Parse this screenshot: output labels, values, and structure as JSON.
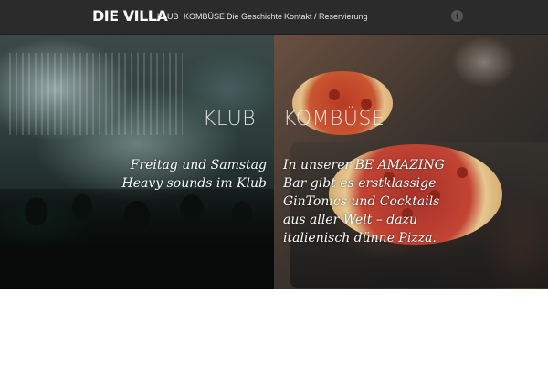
{
  "brand": {
    "logo": "DIE VILLA"
  },
  "nav": {
    "items": [
      {
        "label": "KLUB"
      },
      {
        "label": "KOMBÜSE"
      },
      {
        "label": "Die Geschichte"
      },
      {
        "label": "Kontakt / Reservierung"
      }
    ],
    "social_icon": "facebook-icon",
    "social_glyph": "f"
  },
  "hero": {
    "left": {
      "title": "KLUB",
      "lines": [
        "Freitag und Samstag",
        "Heavy sounds im Klub"
      ]
    },
    "right": {
      "title": "KOMBÜSE",
      "lines": [
        "In unserer BE AMAZING",
        "Bar gibt es erstklassige",
        "GinTonics und Cocktails",
        "aus aller Welt – dazu",
        "italienisch dünne Pizza."
      ]
    }
  },
  "colors": {
    "navbar_bg": "#2b2b2b",
    "page_bg": "#ffffff",
    "text_light": "#ffffff"
  }
}
